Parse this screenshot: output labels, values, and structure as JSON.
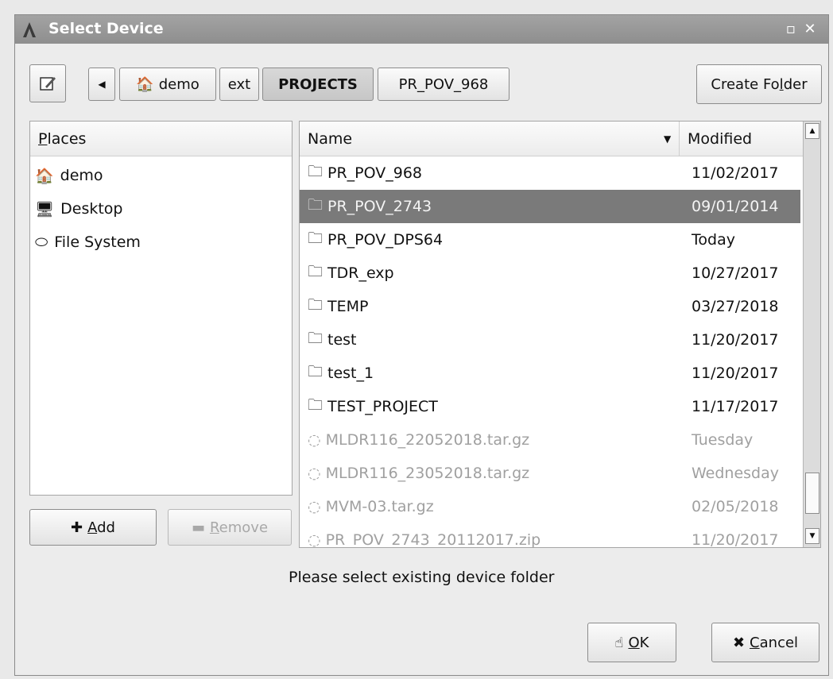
{
  "window": {
    "title": "Select Device"
  },
  "toolbar": {
    "edit_icon": "pencil-icon",
    "back_icon": "left-arrow-icon",
    "path": [
      {
        "label": "demo",
        "icon": "home-icon",
        "active": false
      },
      {
        "label": "ext",
        "active": false
      },
      {
        "label": "PROJECTS",
        "active": true
      },
      {
        "label": "PR_POV_968",
        "active": false
      }
    ],
    "create_folder": {
      "pre": "Create Fo",
      "mnemonic": "l",
      "post": "der"
    }
  },
  "places": {
    "header": {
      "mnemonic": "P",
      "rest": "laces"
    },
    "items": [
      {
        "label": "demo",
        "icon": "home-icon"
      },
      {
        "label": "Desktop",
        "icon": "desktop-icon"
      },
      {
        "label": "File System",
        "icon": "drive-icon"
      }
    ],
    "add": {
      "mnemonic": "A",
      "rest": "dd"
    },
    "remove": {
      "mnemonic": "R",
      "rest": "emove"
    }
  },
  "files": {
    "headers": {
      "name": "Name",
      "modified": "Modified"
    },
    "rows": [
      {
        "name": "PR_POV_968",
        "modified": "11/02/2017",
        "type": "folder"
      },
      {
        "name": "PR_POV_2743",
        "modified": "09/01/2014",
        "type": "folder",
        "selected": true
      },
      {
        "name": "PR_POV_DPS64",
        "modified": "Today",
        "type": "folder"
      },
      {
        "name": "TDR_exp",
        "modified": "10/27/2017",
        "type": "folder"
      },
      {
        "name": "TEMP",
        "modified": "03/27/2018",
        "type": "folder"
      },
      {
        "name": "test",
        "modified": "11/20/2017",
        "type": "folder"
      },
      {
        "name": "test_1",
        "modified": "11/20/2017",
        "type": "folder"
      },
      {
        "name": "TEST_PROJECT",
        "modified": "11/17/2017",
        "type": "folder"
      },
      {
        "name": "MLDR116_22052018.tar.gz",
        "modified": "Tuesday",
        "type": "file"
      },
      {
        "name": "MLDR116_23052018.tar.gz",
        "modified": "Wednesday",
        "type": "file"
      },
      {
        "name": "MVM-03.tar.gz",
        "modified": "02/05/2018",
        "type": "file"
      },
      {
        "name": "PR_POV_2743_20112017.zip",
        "modified": "11/20/2017",
        "type": "file"
      }
    ]
  },
  "message": "Please select existing device folder",
  "buttons": {
    "ok": {
      "mnemonic": "O",
      "rest": "K",
      "icon": "ok-hand-icon"
    },
    "cancel": {
      "mnemonic": "C",
      "rest": "ancel",
      "icon": "x-icon"
    }
  }
}
